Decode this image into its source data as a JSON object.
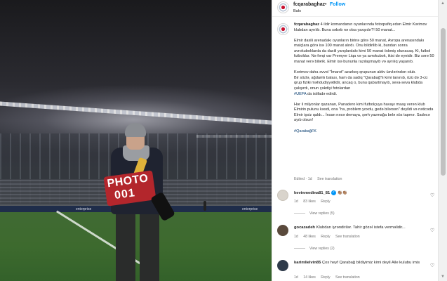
{
  "photo": {
    "vest_line1": "PHOTO",
    "vest_line2": "001",
    "board_text_1": "enterprise",
    "board_text_2": "enterprise"
  },
  "header": {
    "username": "fcqarabaghaz",
    "separator": "•",
    "follow_label": "Follow",
    "location": "Bakı"
  },
  "caption": {
    "username": "fcqarabaghaz",
    "paragraphs": [
      "4 ildir komandanın oyunlarında fotoqrafiq edən Elmir Kərimov klubdan ayrılıb. Buna səbəb nə olsa yaxşıdır?! 50 manat...",
      "Elmir daxili arenadakı oyunların birinə görə 50 manat, Avropa arenasındakı matçlara görə isə 100 manat alırdı. Onu bildirilib ki, bundan sonra avrokuboklarda da daxili yarışlardakı kimi 50 manat ödəniş olunacaq. Ki, futbol futboldur. Nə fərqi var Premyer Liqa və ya avrokubok, ikisi də eynidir. Biz sərə 50 manat verə bilərik. Elmir isə bununla razılaşmayıb və ayrılıq yaşanıb.",
      "Kərimov daha əvvəl \"İmarət\" azarkeş qrupunun aktiv üzvlərindən olub.\nBir sözlə, ağdamlı balası, ham da sadiq \"Qarabağ\"lı kimi tanınıb, özü də 3-cü qrup fiziki məhdudiyyətlidir, ancaq o, bunu qabartmayıb, seva-seva klubda çalışırdı, onun çəkdiyi fotolardan",
      "Hər il milyonlar qazanan, Panadero kimi futbolçuya havayı maaş verən klub Elmirin pulunu kəsdi, ona \"hə, problem yoxdu, gedə bilərsən\" deyildi və nəticədə Elmir işsiz qaldı... İnsan nəsə demaya, şərh yazmağa belə söz tapmır. Sadəcə ayıb olsun!"
    ],
    "uefa_tag": "#UEFA",
    "uefa_tail": "da istifadə edirdi.",
    "hashtag": "#QarabağFK",
    "edited": "Edited · 1d",
    "see_translation": "See translation"
  },
  "comments": [
    {
      "username": "kevinmedina81_81",
      "verified": "✓",
      "text": "👏🏽👏🏽",
      "age": "1d",
      "likes": "83 likes",
      "reply": "Reply",
      "view_replies": "View replies (5)"
    },
    {
      "username": "gocazadeh",
      "text": "Klubdan iyrəndirilər. Tahir gözəl istefa verməlidir...",
      "age": "1d",
      "likes": "48 likes",
      "reply": "Reply",
      "see_translation": "See translation",
      "view_replies": "View replies (2)"
    },
    {
      "username": "karimlielvin85",
      "text": "Çox heyf Qarabağ bildiyimiz kimi deyil Aile kulubu imis",
      "age": "1d",
      "likes": "14 likes",
      "reply": "Reply",
      "see_translation": "See translation"
    }
  ],
  "icons": {
    "heart": "heart-icon",
    "verified": "verified-badge-icon"
  },
  "colors": {
    "accent": "#0095f6",
    "hashtag": "#00376b",
    "muted": "#737373"
  }
}
